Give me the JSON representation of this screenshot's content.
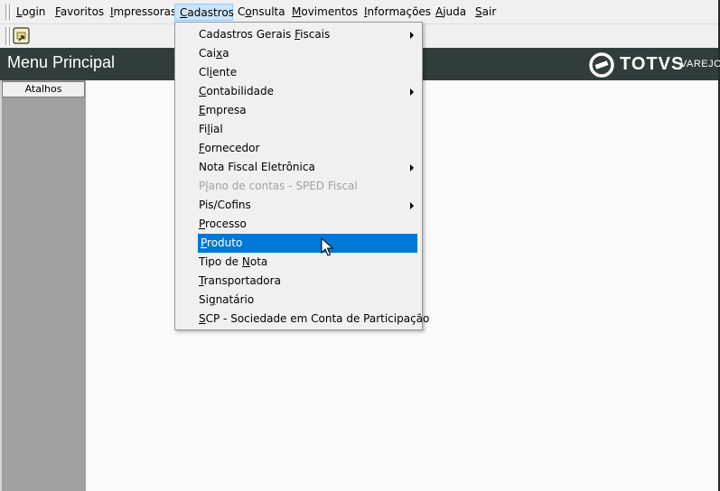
{
  "menubar": {
    "items": [
      {
        "pre": "",
        "key": "L",
        "post": "ogin"
      },
      {
        "pre": "",
        "key": "F",
        "post": "avoritos"
      },
      {
        "pre": "",
        "key": "I",
        "post": "mpressoras"
      },
      {
        "pre": "",
        "key": "C",
        "post": "adastros"
      },
      {
        "pre": "C",
        "key": "o",
        "post": "nsulta"
      },
      {
        "pre": "",
        "key": "M",
        "post": "ovimentos"
      },
      {
        "pre": "",
        "key": "I",
        "post": "nformações"
      },
      {
        "pre": "",
        "key": "A",
        "post": "juda"
      },
      {
        "pre": "",
        "key": "S",
        "post": "air"
      }
    ]
  },
  "header": {
    "title": "Menu Principal",
    "logo_text": "TOTVS",
    "logo_sub": "VAREJO"
  },
  "sidebar": {
    "tab_label": "Atalhos"
  },
  "dropdown": {
    "items": [
      {
        "pre": "Cadastros Gerais ",
        "key": "F",
        "post": "iscais",
        "submenu": true,
        "disabled": false,
        "highlighted": false
      },
      {
        "pre": "Cai",
        "key": "x",
        "post": "a",
        "submenu": false,
        "disabled": false,
        "highlighted": false
      },
      {
        "pre": "Cl",
        "key": "i",
        "post": "ente",
        "submenu": false,
        "disabled": false,
        "highlighted": false
      },
      {
        "pre": "",
        "key": "C",
        "post": "ontabilidade",
        "submenu": true,
        "disabled": false,
        "highlighted": false
      },
      {
        "pre": "",
        "key": "E",
        "post": "mpresa",
        "submenu": false,
        "disabled": false,
        "highlighted": false
      },
      {
        "pre": "Fi",
        "key": "l",
        "post": "ial",
        "submenu": false,
        "disabled": false,
        "highlighted": false
      },
      {
        "pre": "",
        "key": "F",
        "post": "ornecedor",
        "submenu": false,
        "disabled": false,
        "highlighted": false
      },
      {
        "pre": "Nota Fiscal Eletrônica",
        "key": "",
        "post": "",
        "submenu": true,
        "disabled": false,
        "highlighted": false
      },
      {
        "pre": "P",
        "key": "l",
        "post": "ano de contas - SPED Fiscal",
        "submenu": false,
        "disabled": true,
        "highlighted": false
      },
      {
        "pre": "Pis/Cofins",
        "key": "",
        "post": "",
        "submenu": true,
        "disabled": false,
        "highlighted": false
      },
      {
        "pre": "",
        "key": "P",
        "post": "rocesso",
        "submenu": false,
        "disabled": false,
        "highlighted": false
      },
      {
        "pre": "",
        "key": "P",
        "post": "roduto",
        "submenu": false,
        "disabled": false,
        "highlighted": true
      },
      {
        "pre": "Tipo de ",
        "key": "N",
        "post": "ota",
        "submenu": false,
        "disabled": false,
        "highlighted": false
      },
      {
        "pre": "",
        "key": "T",
        "post": "ransportadora",
        "submenu": false,
        "disabled": false,
        "highlighted": false
      },
      {
        "pre": "Si",
        "key": "g",
        "post": "natário",
        "submenu": false,
        "disabled": false,
        "highlighted": false
      },
      {
        "pre": "",
        "key": "S",
        "post": "CP - Sociedade em Conta de Participação",
        "submenu": false,
        "disabled": false,
        "highlighted": false
      }
    ]
  },
  "colors": {
    "header_bg": "#323c3c",
    "highlight": "#0078d7",
    "sidebar_bg": "#a0a0a0"
  },
  "icons": {
    "toolbar_button": "shortcut-icon",
    "cursor": "mouse-pointer-icon"
  }
}
